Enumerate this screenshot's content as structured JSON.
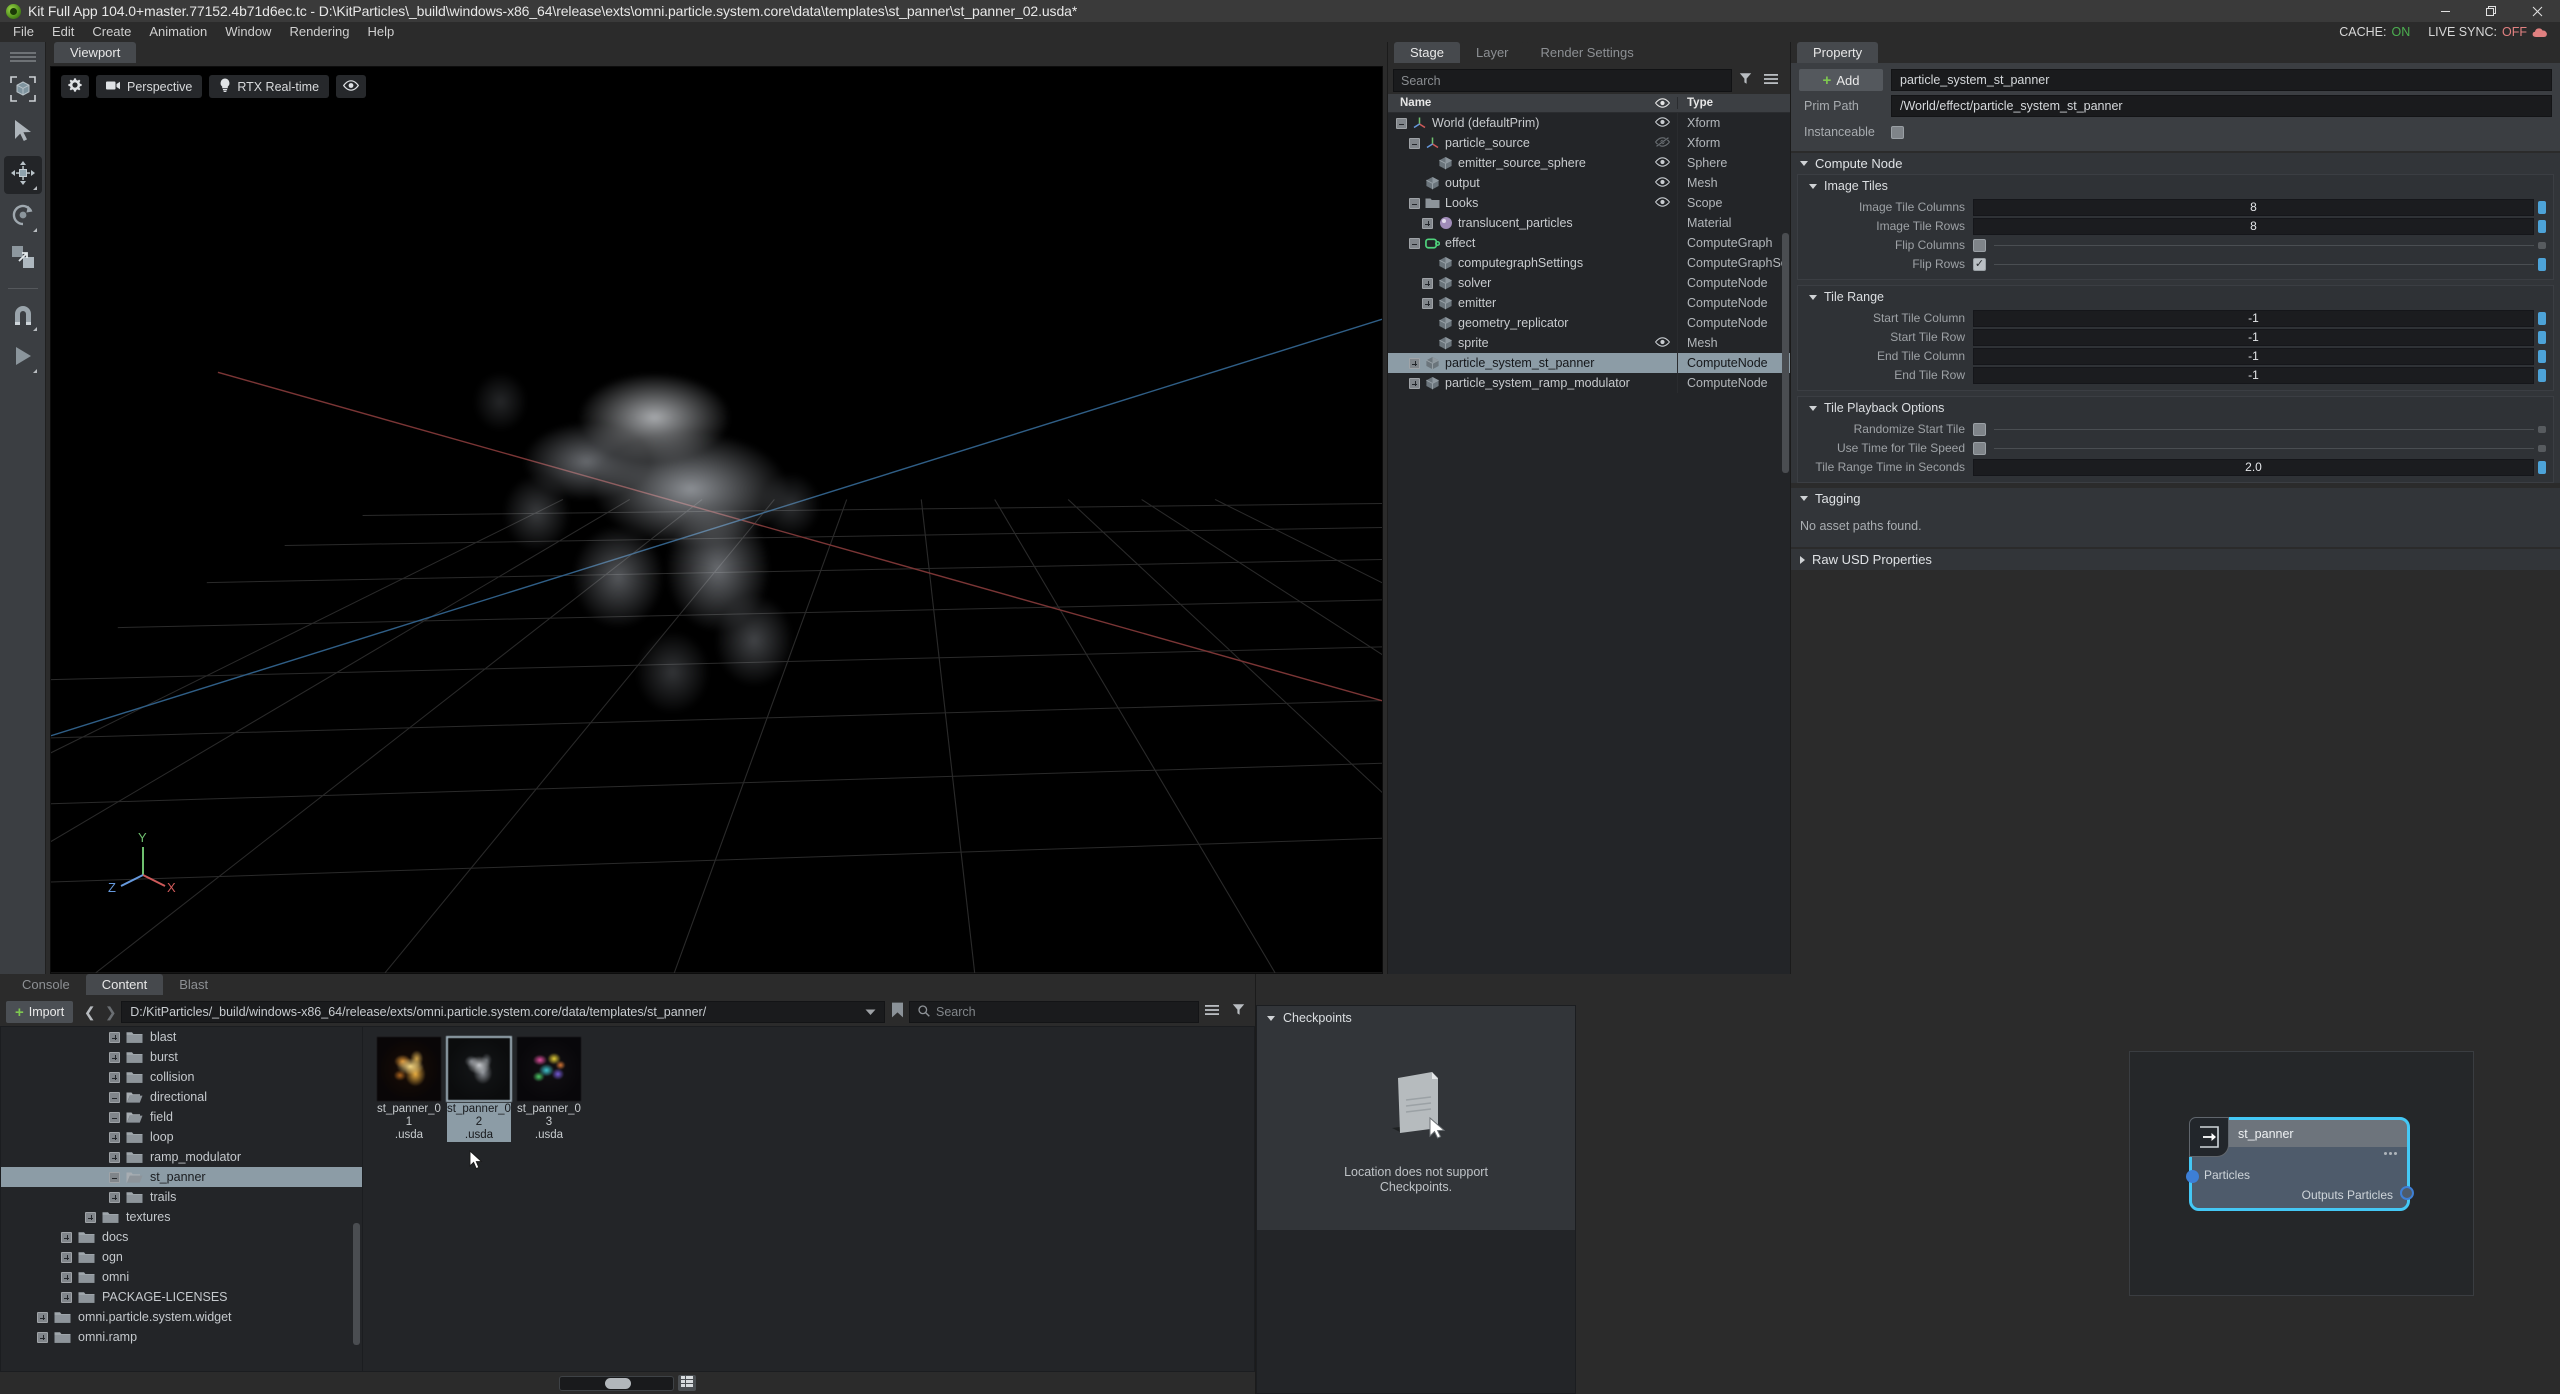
{
  "window": {
    "title": "Kit Full App 104.0+master.77152.4b71d6ec.tc - D:\\KitParticles\\_build\\windows-x86_64\\release\\exts\\omni.particle.system.core\\data\\templates\\st_panner\\st_panner_02.usda*",
    "logo_icon": "omniverse-logo-icon",
    "controls": [
      {
        "name": "minimize-button",
        "icon": "minimize-icon"
      },
      {
        "name": "restore-button",
        "icon": "restore-icon"
      },
      {
        "name": "close-button",
        "icon": "close-icon"
      }
    ]
  },
  "menubar": {
    "items": [
      "File",
      "Edit",
      "Create",
      "Animation",
      "Window",
      "Rendering",
      "Help"
    ],
    "status": {
      "cache_label": "CACHE:",
      "cache_value": "ON",
      "cache_color": "#4caf50",
      "livesync_label": "LIVE SYNC:",
      "livesync_value": "OFF",
      "livesync_color": "#e08080",
      "cloud_icon": "cloud-icon",
      "cloud_color": "#e08080"
    }
  },
  "left_toolbar": {
    "items": [
      {
        "name": "select-bounds-tool",
        "icon": "cube-bracket-icon"
      },
      {
        "name": "select-tool",
        "icon": "cursor-arrow-icon"
      },
      {
        "name": "move-tool",
        "icon": "move-gizmo-icon",
        "active": true
      },
      {
        "name": "rotate-tool",
        "icon": "rotate-gizmo-icon"
      },
      {
        "name": "scale-tool",
        "icon": "scale-gizmo-icon"
      },
      {
        "name": "snap-tool",
        "icon": "magnet-icon"
      },
      {
        "name": "play-tool",
        "icon": "play-icon"
      }
    ]
  },
  "viewport": {
    "tab_label": "Viewport",
    "toolbar": [
      {
        "name": "viewport-settings-button",
        "label": "",
        "icon": "gear-icon"
      },
      {
        "name": "camera-selector-button",
        "label": "Perspective",
        "icon": "camera-icon"
      },
      {
        "name": "renderer-selector-button",
        "label": "RTX Real-time",
        "icon": "lightbulb-icon"
      },
      {
        "name": "visibility-button",
        "label": "",
        "icon": "eye-icon"
      }
    ],
    "axis_gizmo": {
      "x_label": "X",
      "x_color": "#cf5a5a",
      "y_label": "Y",
      "y_color": "#6fc06f",
      "z_label": "Z",
      "z_color": "#6699dd"
    }
  },
  "stage_panel": {
    "tabs": [
      {
        "label": "Stage",
        "active": true
      },
      {
        "label": "Layer",
        "active": false
      },
      {
        "label": "Render Settings",
        "active": false
      }
    ],
    "search_placeholder": "Search",
    "filter_icon": "funnel-icon",
    "options_icon": "hamburger-icon",
    "columns": {
      "name": "Name",
      "eye": "visibility-icon",
      "type": "Type"
    },
    "rows": [
      {
        "label": "World (defaultPrim)",
        "type": "Xform",
        "depth": 0,
        "expander": "minus",
        "icon": "xform-axis-icon",
        "eye": "visible",
        "selected": false
      },
      {
        "label": "particle_source",
        "type": "Xform",
        "depth": 1,
        "expander": "minus",
        "icon": "xform-axis-icon",
        "eye": "hidden",
        "selected": false
      },
      {
        "label": "emitter_source_sphere",
        "type": "Sphere",
        "depth": 2,
        "expander": "none",
        "icon": "mesh-cube-icon",
        "eye": "visible",
        "selected": false
      },
      {
        "label": "output",
        "type": "Mesh",
        "depth": 1,
        "expander": "none",
        "icon": "mesh-cube-icon",
        "eye": "visible",
        "selected": false
      },
      {
        "label": "Looks",
        "type": "Scope",
        "depth": 1,
        "expander": "minus",
        "icon": "folder-icon",
        "eye": "visible",
        "selected": false
      },
      {
        "label": "translucent_particles",
        "type": "Material",
        "depth": 2,
        "expander": "plus",
        "icon": "material-sphere-icon",
        "eye": "none",
        "selected": false
      },
      {
        "label": "effect",
        "type": "ComputeGraph",
        "depth": 1,
        "expander": "minus",
        "icon": "compute-graph-icon",
        "eye": "none",
        "selected": false
      },
      {
        "label": "computegraphSettings",
        "type": "ComputeGraphSe",
        "depth": 2,
        "expander": "none",
        "icon": "mesh-cube-icon",
        "eye": "none",
        "selected": false
      },
      {
        "label": "solver",
        "type": "ComputeNode",
        "depth": 2,
        "expander": "plus",
        "icon": "mesh-cube-icon",
        "eye": "none",
        "selected": false
      },
      {
        "label": "emitter",
        "type": "ComputeNode",
        "depth": 2,
        "expander": "plus",
        "icon": "mesh-cube-icon",
        "eye": "none",
        "selected": false
      },
      {
        "label": "geometry_replicator",
        "type": "ComputeNode",
        "depth": 2,
        "expander": "none",
        "icon": "mesh-cube-icon",
        "eye": "none",
        "selected": false
      },
      {
        "label": "sprite",
        "type": "Mesh",
        "depth": 2,
        "expander": "none",
        "icon": "mesh-cube-icon",
        "eye": "visible",
        "selected": false
      },
      {
        "label": "particle_system_st_panner",
        "type": "ComputeNode",
        "depth": 1,
        "expander": "plus",
        "icon": "mesh-cube-icon",
        "eye": "none",
        "selected": true
      },
      {
        "label": "particle_system_ramp_modulator",
        "type": "ComputeNode",
        "depth": 1,
        "expander": "plus",
        "icon": "mesh-cube-icon",
        "eye": "none",
        "selected": false
      }
    ]
  },
  "property_panel": {
    "tab_label": "Property",
    "add_button": "Add",
    "add_icon": "plus-icon",
    "prim_name_value": "particle_system_st_panner",
    "prim_path_label": "Prim Path",
    "prim_path_value": "/World/effect/particle_system_st_panner",
    "instanceable_label": "Instanceable",
    "instanceable_checked": false,
    "sections": [
      {
        "name": "compute-node",
        "title": "Compute Node",
        "expanded": true,
        "subsections": [
          {
            "name": "image-tiles",
            "title": "Image Tiles",
            "expanded": true,
            "fields": [
              {
                "label": "Image Tile Columns",
                "kind": "number",
                "value": "8",
                "dot": "on"
              },
              {
                "label": "Image Tile Rows",
                "kind": "number",
                "value": "8",
                "dot": "on"
              },
              {
                "label": "Flip Columns",
                "kind": "checkbox",
                "checked": false,
                "dot": "dim"
              },
              {
                "label": "Flip Rows",
                "kind": "checkbox",
                "checked": true,
                "dot": "on"
              }
            ]
          },
          {
            "name": "tile-range",
            "title": "Tile Range",
            "expanded": true,
            "fields": [
              {
                "label": "Start Tile Column",
                "kind": "number",
                "value": "-1",
                "dot": "on"
              },
              {
                "label": "Start Tile Row",
                "kind": "number",
                "value": "-1",
                "dot": "on"
              },
              {
                "label": "End Tile Column",
                "kind": "number",
                "value": "-1",
                "dot": "on"
              },
              {
                "label": "End Tile Row",
                "kind": "number",
                "value": "-1",
                "dot": "on"
              }
            ]
          },
          {
            "name": "tile-playback-options",
            "title": "Tile Playback Options",
            "expanded": true,
            "fields": [
              {
                "label": "Randomize Start Tile",
                "kind": "checkbox",
                "checked": false,
                "dot": "dim"
              },
              {
                "label": "Use Time for Tile Speed",
                "kind": "checkbox",
                "checked": false,
                "dot": "dim"
              },
              {
                "label": "Tile Range Time in Seconds",
                "kind": "number",
                "value": "2.0",
                "dot": "on"
              }
            ]
          }
        ]
      },
      {
        "name": "tagging",
        "title": "Tagging",
        "expanded": true,
        "empty_text": "No asset paths found.",
        "subsections": []
      },
      {
        "name": "raw-usd-properties",
        "title": "Raw USD Properties",
        "expanded": false,
        "subsections": []
      }
    ]
  },
  "bottom_dock": {
    "tabs": [
      {
        "label": "Console",
        "active": false
      },
      {
        "label": "Content",
        "active": true
      },
      {
        "label": "Blast",
        "active": false
      }
    ],
    "import_button": "Import",
    "import_icon": "plus-icon",
    "nav_back_icon": "chevron-left-icon",
    "nav_forward_icon": "chevron-right-icon",
    "path_value": "D:/KitParticles/_build/windows-x86_64/release/exts/omni.particle.system.core/data/templates/st_panner/",
    "path_dropdown_icon": "chevron-down-icon",
    "bookmark_icon": "bookmark-icon",
    "search_placeholder": "Search",
    "search_icon": "search-icon",
    "list_options_icon": "hamburger-icon",
    "filter_icon": "funnel-icon",
    "folder_tree": [
      {
        "label": "blast",
        "depth": 4,
        "expander": "plus",
        "icon": "folder-closed-icon",
        "selected": false
      },
      {
        "label": "burst",
        "depth": 4,
        "expander": "plus",
        "icon": "folder-closed-icon",
        "selected": false
      },
      {
        "label": "collision",
        "depth": 4,
        "expander": "plus",
        "icon": "folder-closed-icon",
        "selected": false
      },
      {
        "label": "directional",
        "depth": 4,
        "expander": "minus",
        "icon": "folder-open-icon",
        "selected": false
      },
      {
        "label": "field",
        "depth": 4,
        "expander": "minus",
        "icon": "folder-open-icon",
        "selected": false
      },
      {
        "label": "loop",
        "depth": 4,
        "expander": "plus",
        "icon": "folder-closed-icon",
        "selected": false
      },
      {
        "label": "ramp_modulator",
        "depth": 4,
        "expander": "plus",
        "icon": "folder-closed-icon",
        "selected": false
      },
      {
        "label": "st_panner",
        "depth": 4,
        "expander": "minus",
        "icon": "folder-open-icon",
        "selected": true
      },
      {
        "label": "trails",
        "depth": 4,
        "expander": "plus",
        "icon": "folder-closed-icon",
        "selected": false
      },
      {
        "label": "textures",
        "depth": 3,
        "expander": "plus",
        "icon": "folder-closed-icon",
        "selected": false
      },
      {
        "label": "docs",
        "depth": 2,
        "expander": "plus",
        "icon": "folder-closed-icon",
        "selected": false
      },
      {
        "label": "ogn",
        "depth": 2,
        "expander": "plus",
        "icon": "folder-closed-icon",
        "selected": false
      },
      {
        "label": "omni",
        "depth": 2,
        "expander": "plus",
        "icon": "folder-closed-icon",
        "selected": false
      },
      {
        "label": "PACKAGE-LICENSES",
        "depth": 2,
        "expander": "plus",
        "icon": "folder-closed-icon",
        "selected": false
      },
      {
        "label": "omni.particle.system.widget",
        "depth": 1,
        "expander": "plus",
        "icon": "folder-closed-icon",
        "selected": false
      },
      {
        "label": "omni.ramp",
        "depth": 1,
        "expander": "plus",
        "icon": "folder-closed-icon",
        "selected": false
      }
    ],
    "thumbnails": [
      {
        "name": "st_panner_01.usda",
        "line1": "st_panner_01",
        "line2": ".usda",
        "selected": false,
        "preview": "orange-fire-particles"
      },
      {
        "name": "st_panner_02.usda",
        "line1": "st_panner_02",
        "line2": ".usda",
        "selected": true,
        "preview": "white-smoke-particles"
      },
      {
        "name": "st_panner_03.usda",
        "line1": "st_panner_03",
        "line2": ".usda",
        "selected": false,
        "preview": "rainbow-particles"
      }
    ],
    "zoom_slider_value": 40,
    "grid_view_icon": "grid-view-icon",
    "checkpoints": {
      "title": "Checkpoints",
      "empty_line1": "Location does not support",
      "empty_line2": "Checkpoints.",
      "empty_icon": "document-cursor-icon"
    }
  },
  "node_graph": {
    "node_title": "st_panner",
    "node_icon": "arrow-into-box-icon",
    "input_port_label": "Particles",
    "output_port_label": "Outputs Particles",
    "menu_dots_icon": "ellipsis-icon",
    "selection_color": "#44c8f5",
    "port_color": "#3d7fd6"
  }
}
